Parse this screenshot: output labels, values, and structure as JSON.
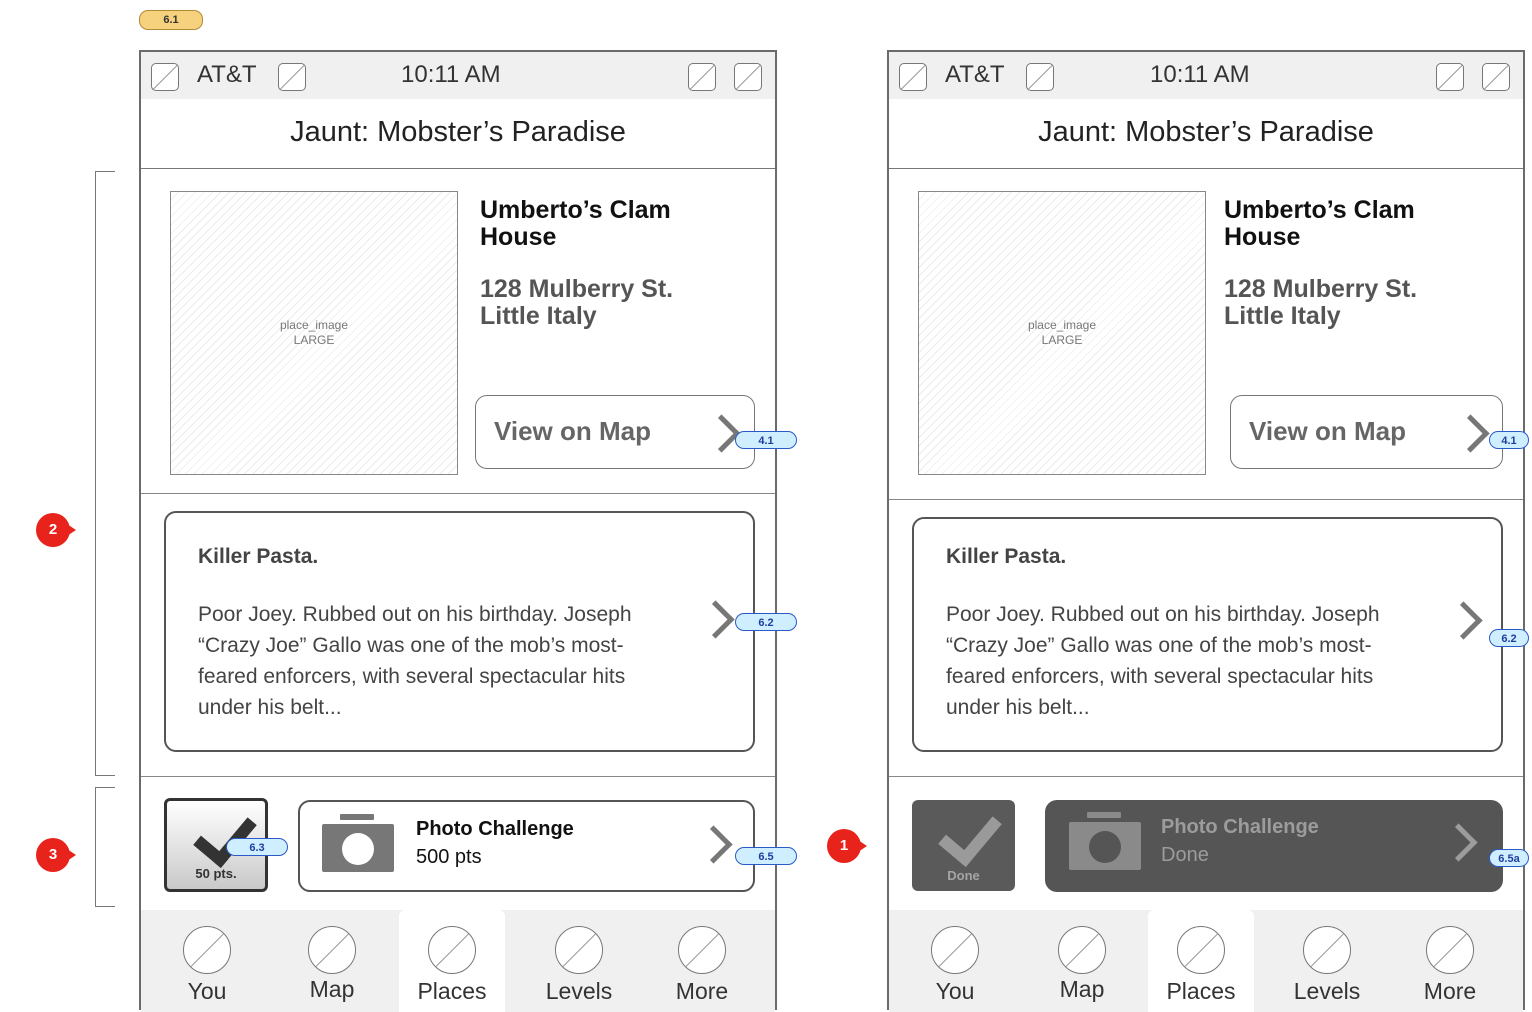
{
  "top_tag": "6.1",
  "left_phone": {
    "status": {
      "carrier": "AT&T",
      "time": "10:11 AM"
    },
    "title": "Jaunt: Mobster’s Paradise",
    "place": {
      "name": "Umberto’s Clam House",
      "address_line1": "128 Mulberry St.",
      "address_line2": "Little Italy",
      "image_label1": "place_image",
      "image_label2": "LARGE"
    },
    "map_button": {
      "label": "View on Map",
      "tag": "4.1"
    },
    "story": {
      "title": "Killer Pasta.",
      "body": "Poor Joey. Rubbed out on his birthday. Joseph “Crazy Joe” Gallo was one of the mob’s most-feared enforcers, with several spectacular hits under his belt...",
      "tag": "6.2"
    },
    "checkin": {
      "label": "50 pts.",
      "tag": "6.3"
    },
    "challenge": {
      "title": "Photo Challenge",
      "subtitle": "500 pts",
      "tag": "6.5"
    },
    "tabs": [
      {
        "label": "You"
      },
      {
        "label": "Map"
      },
      {
        "label": "Places"
      },
      {
        "label": "Levels"
      },
      {
        "label": "More"
      }
    ],
    "selected_tab": "Places"
  },
  "right_phone": {
    "status": {
      "carrier": "AT&T",
      "time": "10:11 AM"
    },
    "title": "Jaunt: Mobster’s Paradise",
    "place": {
      "name": "Umberto’s Clam House",
      "address_line1": "128 Mulberry St.",
      "address_line2": "Little Italy",
      "image_label1": "place_image",
      "image_label2": "LARGE"
    },
    "map_button": {
      "label": "View on Map",
      "tag": "4.1"
    },
    "story": {
      "title": "Killer Pasta.",
      "body": "Poor Joey. Rubbed out on his birthday. Joseph “Crazy Joe” Gallo was one of the mob’s most-feared enforcers, with several spectacular hits under his belt...",
      "tag": "6.2"
    },
    "checkin": {
      "label": "Done"
    },
    "challenge": {
      "title": "Photo Challenge",
      "subtitle": "Done",
      "tag": "6.5a"
    },
    "tabs": [
      {
        "label": "You"
      },
      {
        "label": "Map"
      },
      {
        "label": "Places"
      },
      {
        "label": "Levels"
      },
      {
        "label": "More"
      }
    ],
    "selected_tab": "Places"
  },
  "annotations": {
    "badge_story": "2",
    "badge_actions": "3",
    "badge_done": "1"
  },
  "colors": {
    "badge_red": "#e8231c",
    "tag_blue": "#cfeeff",
    "tag_yellow": "#f6d27e",
    "done_gray": "#555555"
  }
}
